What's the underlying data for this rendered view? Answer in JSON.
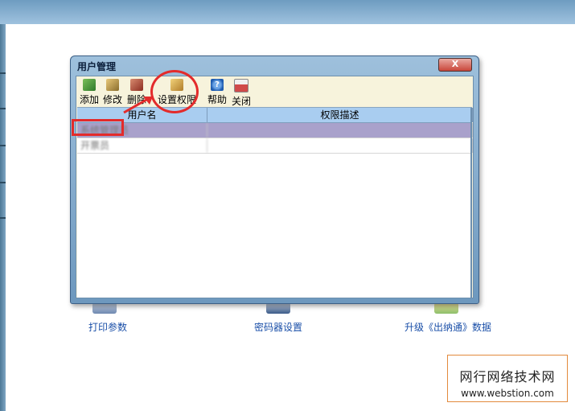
{
  "dialog": {
    "title": "用户管理",
    "close_label": "X",
    "toolbar": [
      {
        "label": "添加",
        "icon": "add-user-icon"
      },
      {
        "label": "修改",
        "icon": "edit-user-icon"
      },
      {
        "label": "删除",
        "icon": "delete-user-icon"
      },
      {
        "label": "设置权限",
        "icon": "permission-icon"
      },
      {
        "label": "帮助",
        "icon": "help-icon"
      },
      {
        "label": "关闭",
        "icon": "close-window-icon"
      }
    ],
    "table": {
      "columns": [
        "用户名",
        "权限描述"
      ],
      "rows": [
        {
          "username": "系统管理员",
          "description": ""
        },
        {
          "username": "开票员",
          "description": ""
        }
      ]
    }
  },
  "background": {
    "items": [
      {
        "label": "打印参数",
        "icon": "printer-icon"
      },
      {
        "label": "密码器设置",
        "icon": "password-device-icon"
      },
      {
        "label": "升级《出纳通》数据",
        "icon": "upgrade-icon"
      }
    ]
  },
  "watermark": {
    "line1": "网行网络技术网",
    "line2": "www.webstion.com"
  },
  "colors": {
    "selected_row": "#a9a1cb",
    "header": "#a9cdf0",
    "annotation": "#e32b2b",
    "link_text": "#1a4fa8"
  }
}
